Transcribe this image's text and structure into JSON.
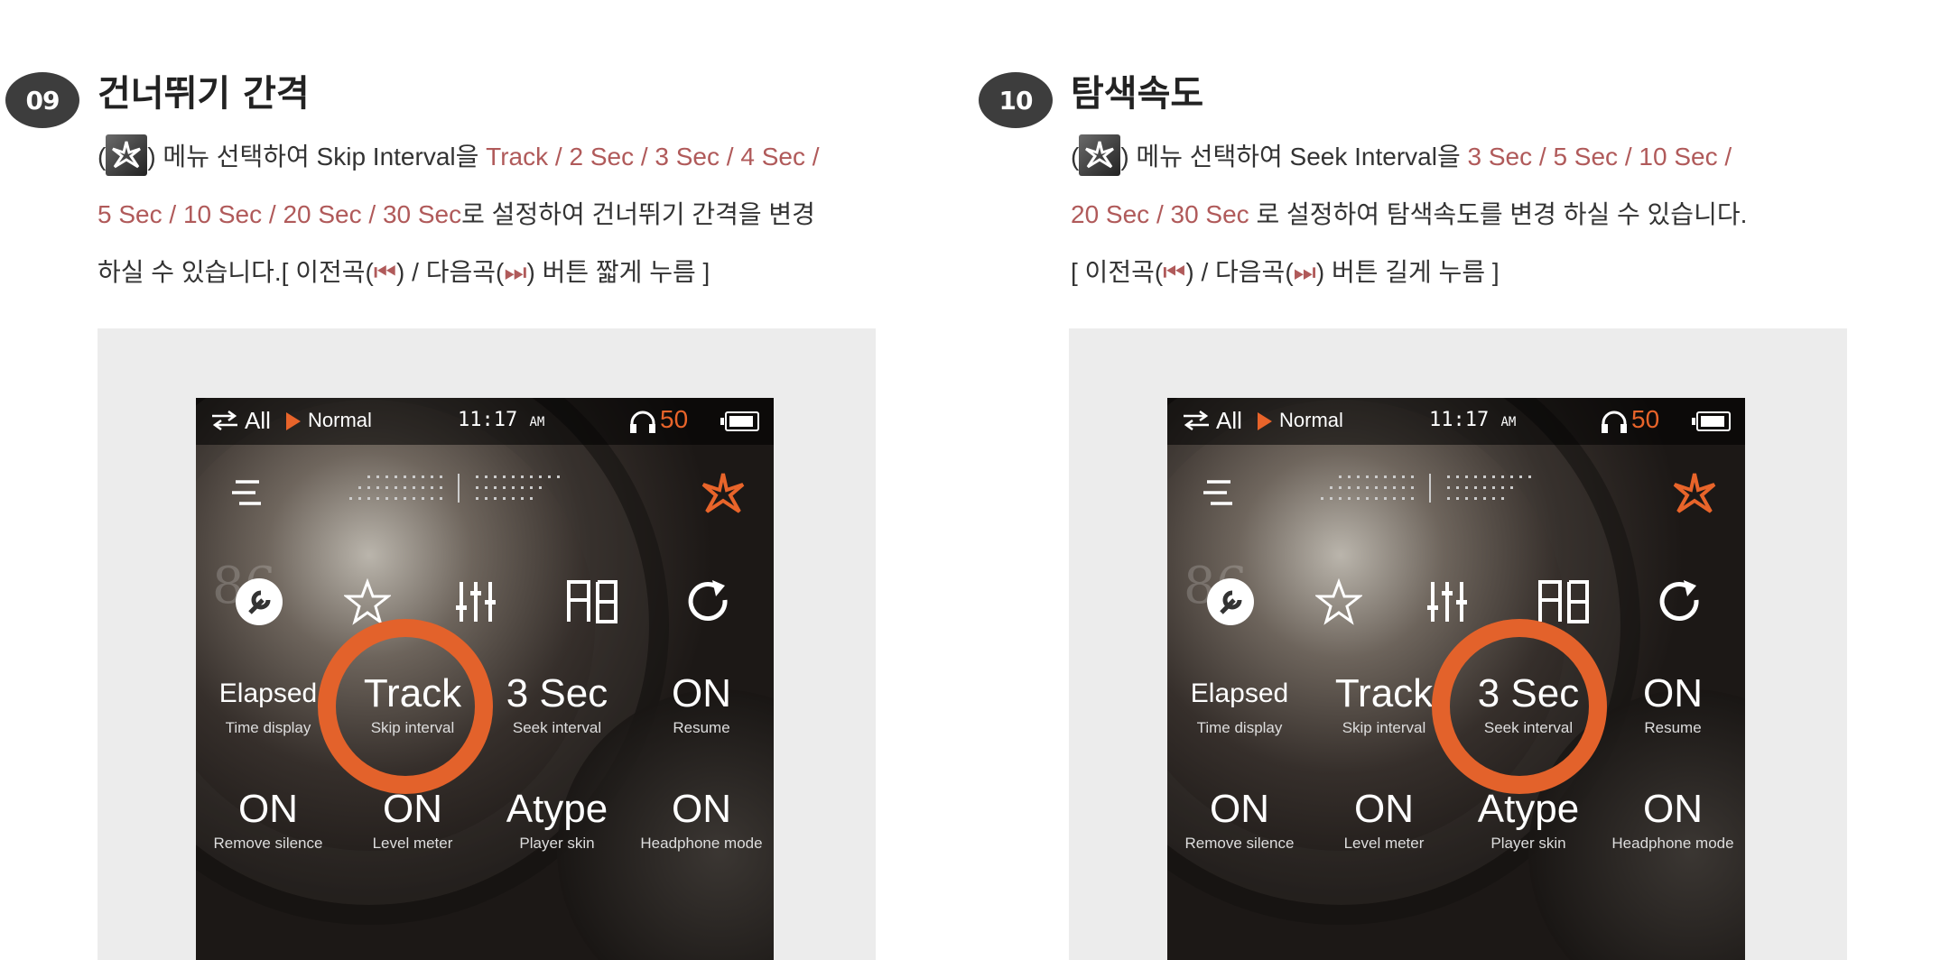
{
  "sections": [
    {
      "number": "09",
      "title": "건너뛰기 간격",
      "line1_pre": "(",
      "line1_mid": ") 메뉴 선택하여 Skip Interval을 ",
      "line1_red": "Track / 2 Sec / 3 Sec / 4 Sec /",
      "line2_red": "5 Sec / 10 Sec / 20 Sec / 30 Sec",
      "line2_post": "로 설정하여 건너뛰기 간격을 변경",
      "line3_a": "하실 수 있습니다.[ 이전곡(",
      "line3_b": ") / 다음곡(",
      "line3_c": ") 버튼 짧게 누름 ]"
    },
    {
      "number": "10",
      "title": "탐색속도",
      "line1_pre": "(",
      "line1_mid": ") 메뉴 선택하여 Seek Interval을  ",
      "line1_red": "3 Sec / 5 Sec / 10 Sec /",
      "line2_red": "20 Sec / 30 Sec",
      "line2_post": " 로 설정하여 탐색속도를 변경 하실 수 있습니다.",
      "line3_a": "[ 이전곡(",
      "line3_b": ") / 다음곡(",
      "line3_c": ") 버튼 길게 누름 ]"
    }
  ],
  "device": {
    "status": {
      "repeat": "All",
      "mode": "Normal",
      "time": "11:17",
      "ampm": "AM",
      "volume": "50"
    },
    "bg_number": "86",
    "grid": [
      {
        "value": "Elapsed",
        "caption": "Time display"
      },
      {
        "value": "Track",
        "caption": "Skip interval"
      },
      {
        "value": "3 Sec",
        "caption": "Seek interval"
      },
      {
        "value": "ON",
        "caption": "Resume"
      },
      {
        "value": "ON",
        "caption": "Remove silence"
      },
      {
        "value": "ON",
        "caption": "Level meter"
      },
      {
        "value": "Atype",
        "caption": "Player skin"
      },
      {
        "value": "ON",
        "caption": "Headphone mode"
      }
    ]
  },
  "prev_symbol": "⏮",
  "next_symbol": "⏭",
  "colors": {
    "accent_orange": "#e3622b",
    "highlight_red": "#b05a5a",
    "frame_gray": "#ececec"
  }
}
